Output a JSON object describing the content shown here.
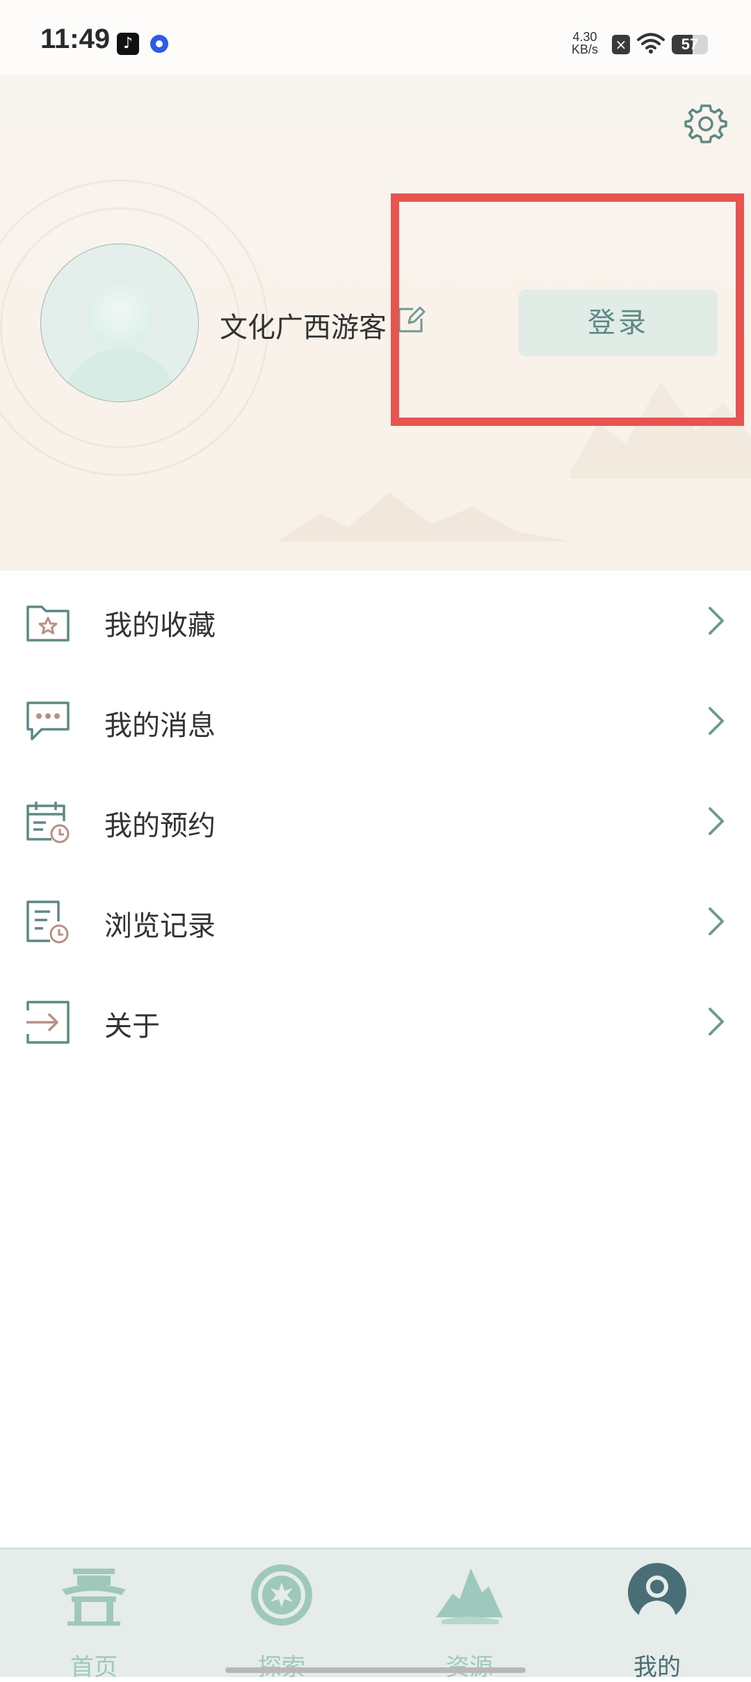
{
  "status_bar": {
    "time": "11:49",
    "net_speed_value": "4.30",
    "net_speed_unit": "KB/s",
    "battery": "57",
    "battery_level": 0.57
  },
  "header": {
    "username": "文化广西游客",
    "login_label": "登录",
    "accent_color": "#5d8985",
    "highlight_color": "#e85450"
  },
  "menu": {
    "items": [
      {
        "label": "我的收藏",
        "icon": "favorites-folder-star-icon"
      },
      {
        "label": "我的消息",
        "icon": "message-bubble-icon"
      },
      {
        "label": "我的预约",
        "icon": "calendar-clock-icon"
      },
      {
        "label": "浏览记录",
        "icon": "history-document-clock-icon"
      },
      {
        "label": "关于",
        "icon": "arrow-into-box-icon"
      }
    ]
  },
  "tabbar": {
    "tabs": [
      {
        "label": "首页",
        "icon": "pavilion-icon",
        "active": false
      },
      {
        "label": "探索",
        "icon": "compass-sun-icon",
        "active": false
      },
      {
        "label": "资源",
        "icon": "mountains-icon",
        "active": false
      },
      {
        "label": "我的",
        "icon": "person-icon",
        "active": true
      }
    ],
    "active_color": "#4a6e76",
    "inactive_color": "#9fc8bd"
  }
}
